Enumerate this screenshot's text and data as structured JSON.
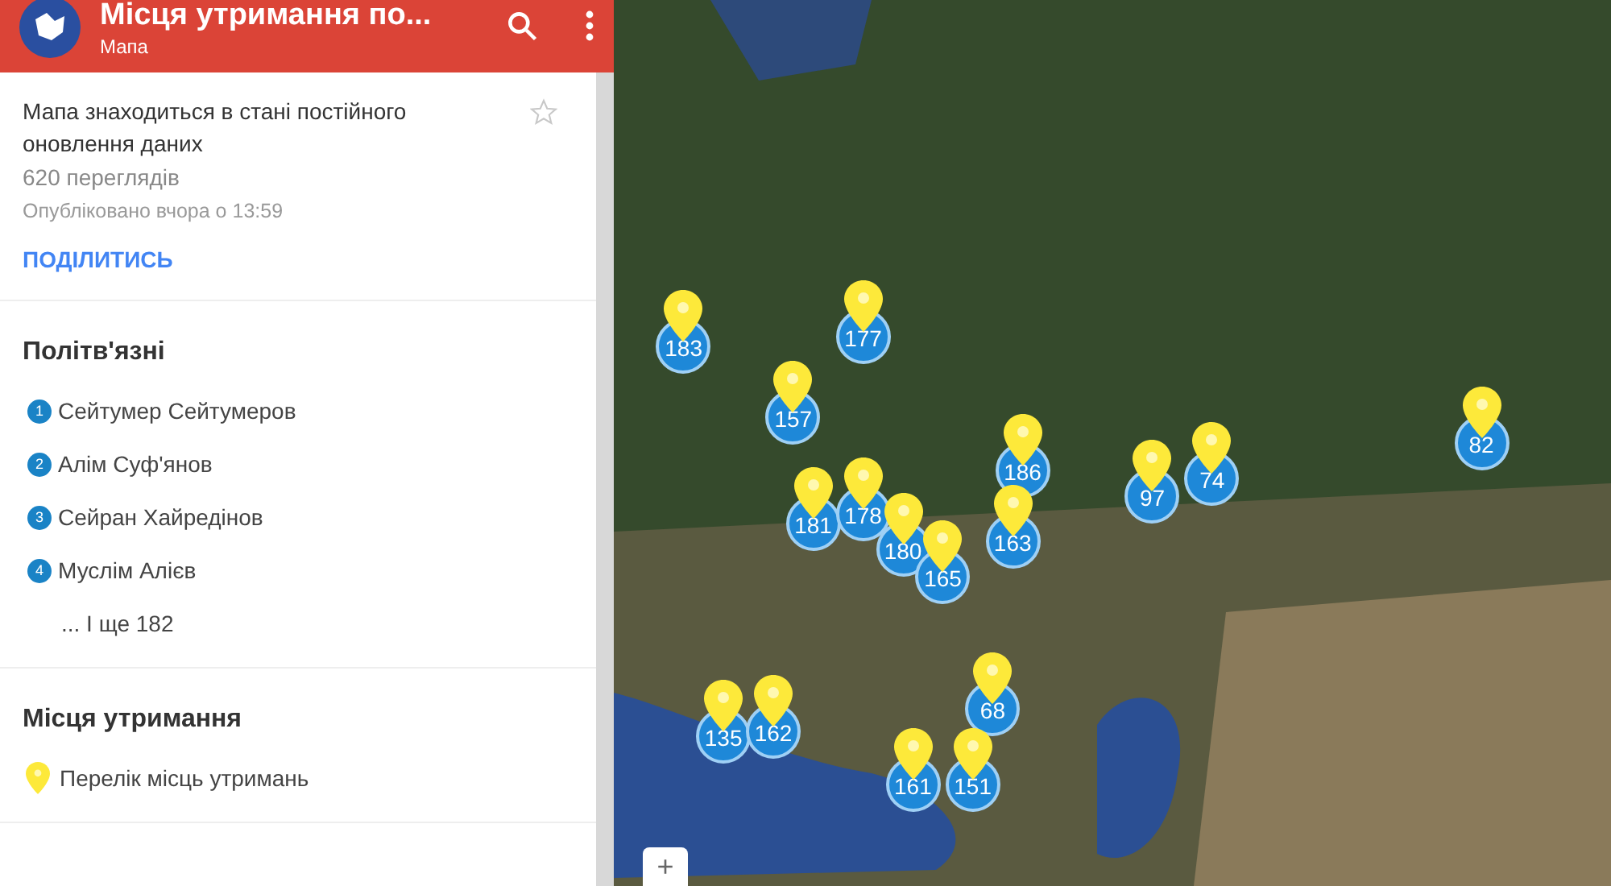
{
  "header": {
    "title": "Місця утримання по...",
    "subtitle": "Мапа"
  },
  "info": {
    "description": "Мапа знаходиться в стані постійного оновлення даних",
    "views": "620 переглядів",
    "published": "Опубліковано вчора о 13:59",
    "share": "ПОДІЛИТИСЬ",
    "starred": false
  },
  "layers": [
    {
      "title": "Політв'язні",
      "items": [
        {
          "kind": "numbered",
          "badge": "1",
          "label": "Сейтумер Сейтумеров"
        },
        {
          "kind": "numbered",
          "badge": "2",
          "label": "Алім Суф'янов"
        },
        {
          "kind": "numbered",
          "badge": "3",
          "label": "Сейран Хайредінов"
        },
        {
          "kind": "numbered",
          "badge": "4",
          "label": "Муслім Алієв"
        },
        {
          "kind": "more",
          "label": "... І ще 182"
        }
      ]
    },
    {
      "title": "Місця утримання",
      "items": [
        {
          "kind": "pin",
          "label": "Перелік місць утримань"
        }
      ]
    }
  ],
  "map": {
    "zoom_in": "+",
    "markers": [
      {
        "count": "183"
      },
      {
        "count": "177"
      },
      {
        "count": "157"
      },
      {
        "count": "181"
      },
      {
        "count": "178"
      },
      {
        "count": "180"
      },
      {
        "count": "165"
      },
      {
        "count": "186"
      },
      {
        "count": "163"
      },
      {
        "count": "97"
      },
      {
        "count": "74"
      },
      {
        "count": "82"
      },
      {
        "count": "135"
      },
      {
        "count": "162"
      },
      {
        "count": "68"
      },
      {
        "count": "161"
      },
      {
        "count": "151"
      }
    ]
  }
}
